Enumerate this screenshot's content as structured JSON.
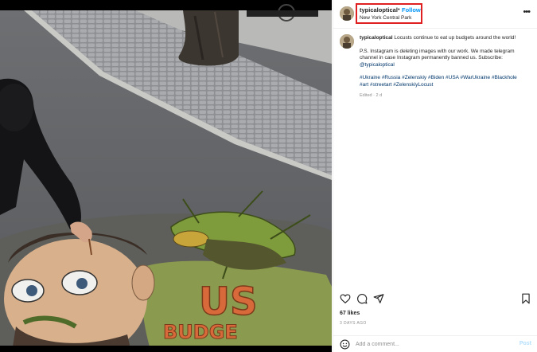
{
  "post": {
    "username": "typicaloptical",
    "follow_label": "Follow",
    "separator": "•",
    "location": "New York Central Park",
    "more_icon": "more-horizontal-icon"
  },
  "caption": {
    "username": "typicaloptical",
    "line1": "Locusts continue to eat up budgets around the world!",
    "line2": "P.S. Instagram is deleting images with our work. We made telegram channel in case Instagram permanently banned us. Subscribe: ",
    "subscribe_handle": "@typicaloptical",
    "hashtags": "#Ukraine #Russia #Zelenskiy #Biden #USA #WarUkraine #Blackhole #art #streetart #ZelenskiyLocust",
    "edited": "Edited · 2 d"
  },
  "actions": {
    "icons": [
      "heart-icon",
      "comment-icon",
      "share-icon",
      "bookmark-icon"
    ]
  },
  "likes": "67 likes",
  "time_ago": "3 DAYS AGO",
  "add_comment": {
    "placeholder": "Add a comment...",
    "post_label": "Post"
  },
  "colors": {
    "accent": "#0095f6",
    "highlight": "#e02020",
    "post_disabled": "#b2dffc"
  }
}
